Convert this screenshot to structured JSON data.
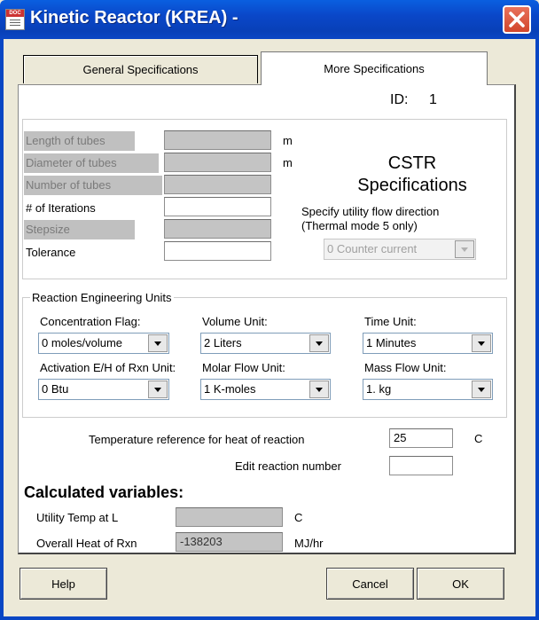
{
  "window": {
    "title": "Kinetic Reactor (KREA) -",
    "icon": "doc-icon",
    "icon_text": "DOC"
  },
  "tabs": [
    {
      "label": "General Specifications",
      "active": false
    },
    {
      "label": "More Specifications",
      "active": true
    }
  ],
  "id": {
    "label": "ID:",
    "value": "1"
  },
  "tube_fields": [
    {
      "label": "Length of tubes",
      "value": "",
      "unit": "m",
      "enabled": false
    },
    {
      "label": "Diameter of tubes",
      "value": "",
      "unit": "m",
      "enabled": false
    },
    {
      "label": "Number of tubes",
      "value": "",
      "unit": "",
      "enabled": false
    },
    {
      "label": "# of Iterations",
      "value": "",
      "unit": "",
      "enabled": true
    },
    {
      "label": "Stepsize",
      "value": "",
      "unit": "",
      "enabled": false
    },
    {
      "label": "Tolerance",
      "value": "",
      "unit": "",
      "enabled": true
    }
  ],
  "cstr": {
    "heading_line1": "CSTR",
    "heading_line2": "Specifications",
    "flow_label_line1": "Specify utility flow direction",
    "flow_label_line2": "(Thermal mode 5 only)",
    "flow_value": "0 Counter current"
  },
  "reaction_units": {
    "legend": "Reaction Engineering Units",
    "fields": [
      {
        "label": "Concentration Flag:",
        "value": "0 moles/volume"
      },
      {
        "label": "Volume Unit:",
        "value": "2 Liters"
      },
      {
        "label": "Time Unit:",
        "value": "1 Minutes"
      },
      {
        "label": "Activation E/H of Rxn Unit:",
        "value": "0 Btu"
      },
      {
        "label": "Molar Flow Unit:",
        "value": "1 K-moles"
      },
      {
        "label": "Mass Flow Unit:",
        "value": "1. kg"
      }
    ]
  },
  "temp_ref": {
    "label": "Temperature reference for heat of  reaction",
    "value": "25",
    "unit": "C"
  },
  "edit_rxn": {
    "label": "Edit reaction number",
    "value": ""
  },
  "calculated": {
    "title": "Calculated variables:",
    "rows": [
      {
        "label": "Utility Temp at L",
        "value": "",
        "unit": "C"
      },
      {
        "label": "Overall Heat of Rxn",
        "value": "-138203",
        "unit": "MJ/hr"
      }
    ]
  },
  "buttons": {
    "help": "Help",
    "cancel": "Cancel",
    "ok": "OK"
  },
  "colors": {
    "titlebar": "#0a47c8",
    "close": "#d2462c",
    "dialog_bg": "#ece9d8",
    "disabled_field": "#c4c4c4"
  }
}
